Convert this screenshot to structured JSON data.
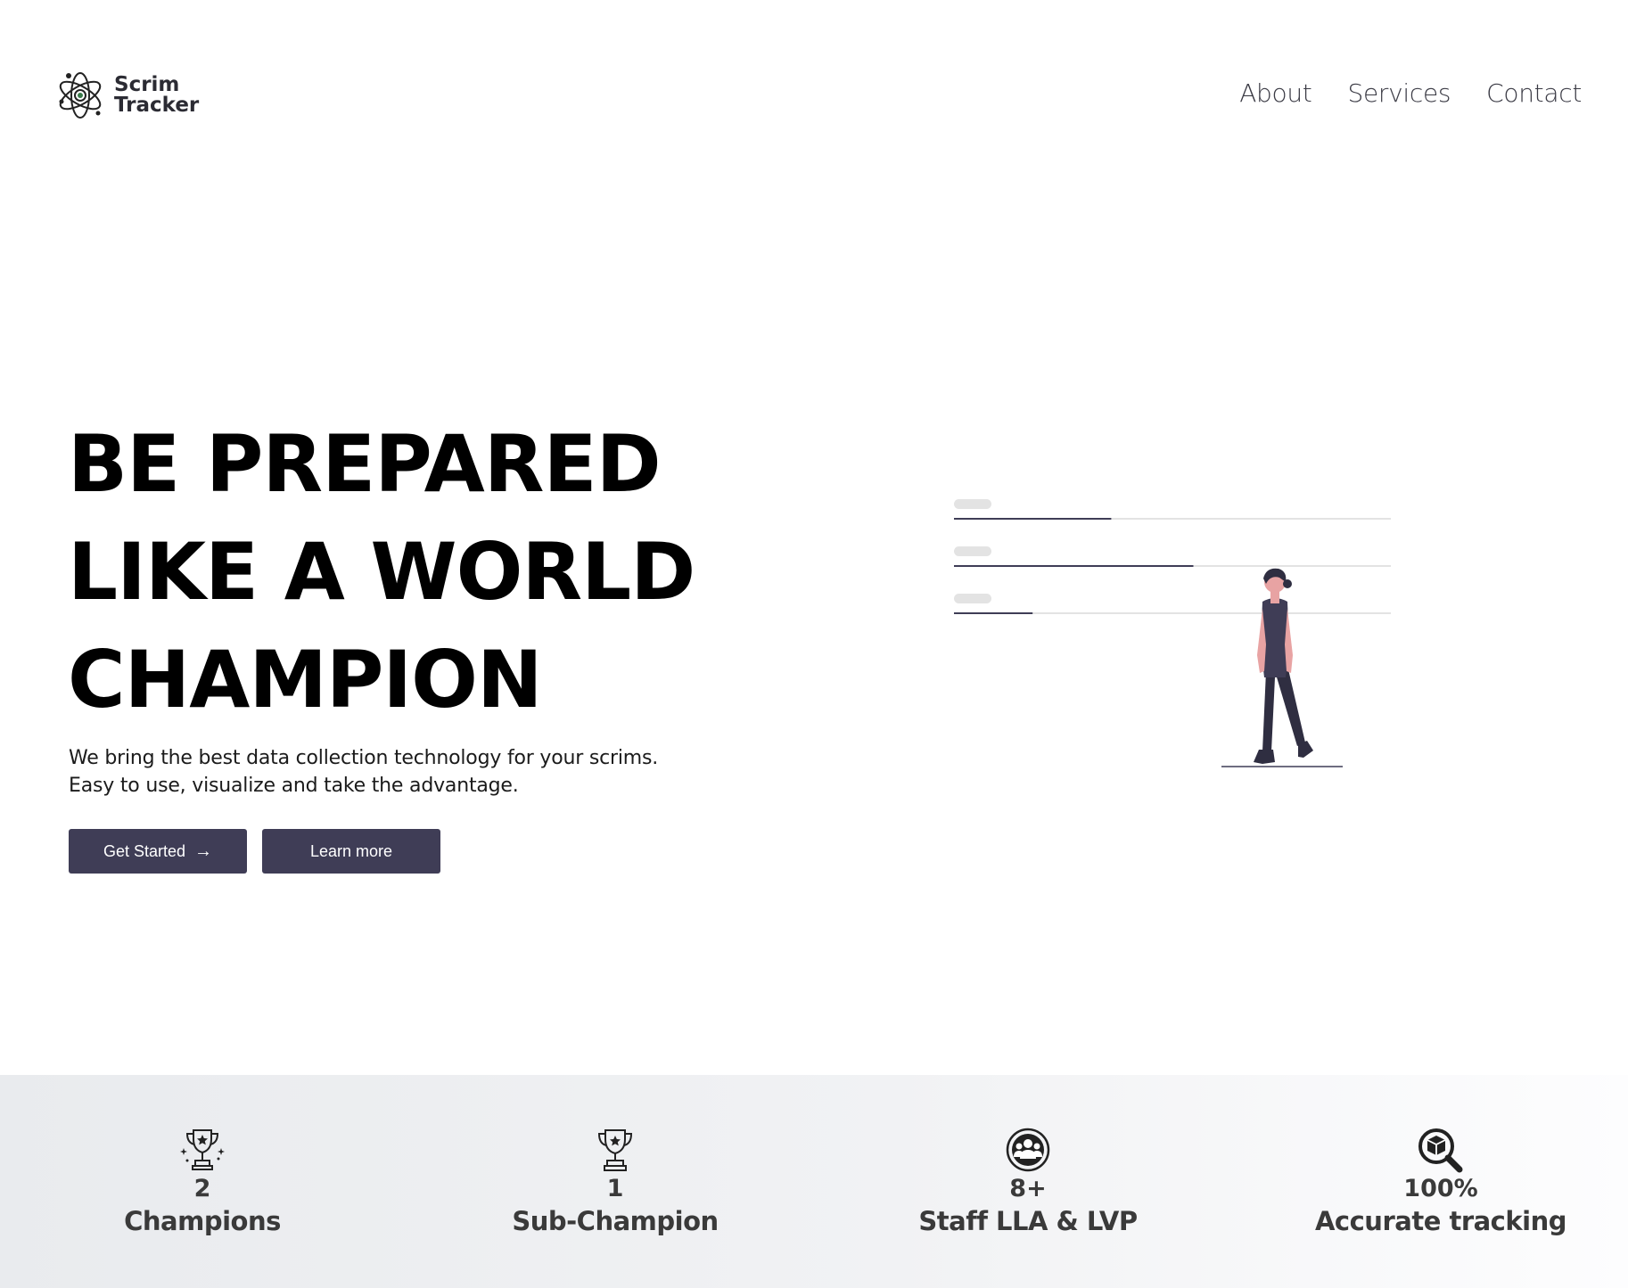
{
  "brand": {
    "line1": "Scrim",
    "line2": "Tracker",
    "icon": "atom-icon"
  },
  "nav": {
    "items": [
      "About",
      "Services",
      "Contact"
    ]
  },
  "hero": {
    "title_lines": [
      "BE PREPARED",
      "LIKE A WORLD",
      "CHAMPION"
    ],
    "subtitle_lines": [
      "We bring the best data collection technology for your scrims.",
      "Easy to use, visualize and take the advantage."
    ],
    "buttons": {
      "get_started": "Get Started",
      "learn_more": "Learn more"
    }
  },
  "illustration": {
    "progress": [
      0.36,
      0.548,
      0.18
    ],
    "accent": "#3f3d56"
  },
  "stats": [
    {
      "icon": "trophy-sparkle-icon",
      "value": "2",
      "label": "Champions"
    },
    {
      "icon": "trophy-icon",
      "value": "1",
      "label": "Sub-Champion"
    },
    {
      "icon": "staff-group-icon",
      "value": "8+",
      "label": "Staff LLA & LVP"
    },
    {
      "icon": "magnifier-cube-icon",
      "value": "100%",
      "label": "Accurate tracking"
    }
  ],
  "colors": {
    "button_bg": "#3f3d56",
    "stats_bg": "#eceef1",
    "text_dark": "#000000"
  }
}
